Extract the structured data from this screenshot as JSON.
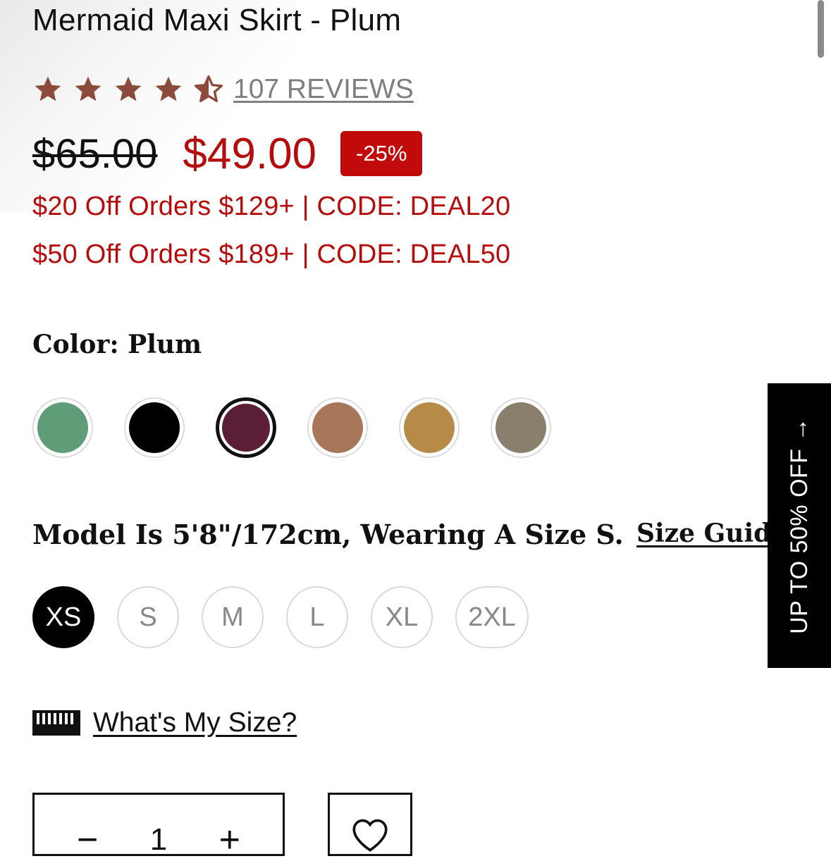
{
  "product": {
    "title": "Mermaid Maxi Skirt - Plum",
    "rating": 4.5,
    "rating_max": 5,
    "reviews_label": "107 REVIEWS",
    "star_color": "#8b4a3a"
  },
  "pricing": {
    "original_price": "$65.00",
    "sale_price": "$49.00",
    "discount_badge": "-25%",
    "sale_color": "#b70c0c"
  },
  "promos": [
    "$20 Off Orders $129+ | CODE: DEAL20",
    "$50 Off Orders $189+ | CODE: DEAL50"
  ],
  "color_selector": {
    "label": "Color: Plum",
    "swatches": [
      {
        "color": "#5f9c78",
        "selected": false
      },
      {
        "color": "#000000",
        "selected": false
      },
      {
        "color": "#5a1e36",
        "selected": true
      },
      {
        "color": "#a8775a",
        "selected": false
      },
      {
        "color": "#b68a47",
        "selected": false
      },
      {
        "color": "#8a7f6c",
        "selected": false
      }
    ]
  },
  "size_selector": {
    "model_info": "Model Is 5'8\"/172cm, Wearing A Size S.",
    "size_guide_label": "Size Guide",
    "sizes": [
      {
        "label": "XS",
        "selected": true
      },
      {
        "label": "S",
        "selected": false
      },
      {
        "label": "M",
        "selected": false
      },
      {
        "label": "L",
        "selected": false
      },
      {
        "label": "XL",
        "selected": false
      },
      {
        "label": "2XL",
        "selected": false
      }
    ]
  },
  "fit_finder": {
    "icon": "ruler-icon",
    "label": "What's My Size?"
  },
  "quantity": {
    "minus_label": "−",
    "value": "1",
    "plus_label": "+"
  },
  "wishlist": {
    "icon": "heart-icon"
  },
  "side_tab": {
    "label": "UP TO 50% OFF →"
  }
}
